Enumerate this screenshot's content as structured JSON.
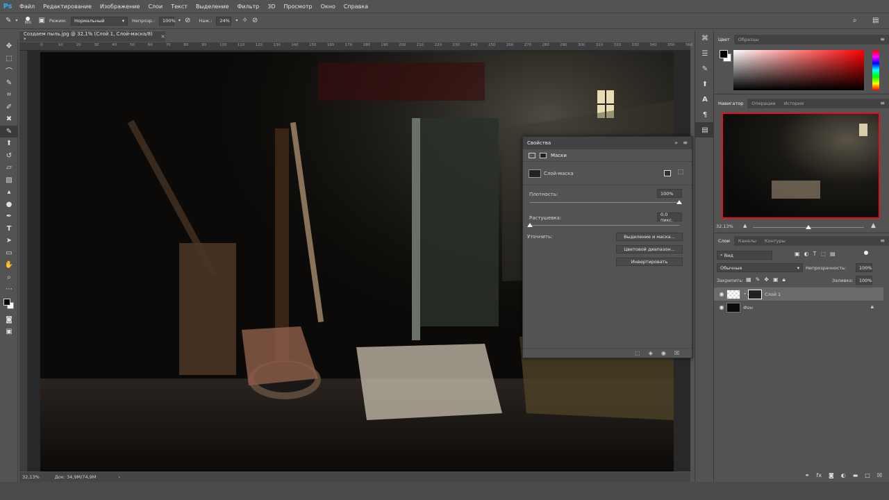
{
  "app": {
    "logo": "Ps"
  },
  "menu": [
    "Файл",
    "Редактирование",
    "Изображение",
    "Слои",
    "Текст",
    "Выделение",
    "Фильтр",
    "3D",
    "Просмотр",
    "Окно",
    "Справка"
  ],
  "options": {
    "brush_size": "800",
    "mode_label": "Режим:",
    "mode_value": "Нормальный",
    "opacity_label": "Непрозр.:",
    "opacity_value": "100%",
    "pressure_label": "Наж.:",
    "pressure_value": "24%"
  },
  "document": {
    "tab_title": "Создаем пыль.jpg @ 32,1% (Слой 1, Слой-маска/8) *",
    "zoom": "32,13%",
    "doc_size": "Док: 34,9M/74,9M"
  },
  "ruler_marks": [
    "0",
    "10",
    "20",
    "30",
    "40",
    "50",
    "60",
    "70",
    "80",
    "90",
    "100",
    "110",
    "120",
    "130",
    "140",
    "150",
    "160",
    "170",
    "180",
    "190",
    "200",
    "210",
    "220",
    "230",
    "240",
    "250",
    "260",
    "270",
    "280",
    "290",
    "300",
    "310",
    "320",
    "330",
    "340",
    "350",
    "360"
  ],
  "tools": [
    "move",
    "marquee",
    "lasso",
    "quick-select",
    "crop",
    "eyedropper",
    "healing",
    "brush",
    "stamp",
    "history-brush",
    "eraser",
    "gradient",
    "blur",
    "dodge",
    "pen",
    "type",
    "path-select",
    "shape",
    "hand",
    "zoom",
    "more",
    "colors",
    "quickmask",
    "screenmode"
  ],
  "properties": {
    "title": "Свойства",
    "section": "Маски",
    "mask_name": "Слой-маска",
    "density_label": "Плотность:",
    "density_value": "100%",
    "density_fraction": 1.0,
    "feather_label": "Растушевка:",
    "feather_value": "0,0 пикс.",
    "feather_fraction": 0.0,
    "refine_label": "Уточнить:",
    "btn_select_mask": "Выделение и маска...",
    "btn_color_range": "Цветовой диапазон...",
    "btn_invert": "Инвертировать"
  },
  "color_panel": {
    "tabs": [
      "Цвет",
      "Образцы"
    ],
    "fg": "#000000",
    "bg": "#ffffff"
  },
  "navigator": {
    "tabs": [
      "Навигатор",
      "Операции",
      "История"
    ],
    "zoom": "32,13%",
    "zoom_fraction": 0.5
  },
  "layers_panel": {
    "tabs": [
      "Слои",
      "Каналы",
      "Контуры"
    ],
    "filter_kind": "Вид",
    "blend_mode": "Обычные",
    "opacity_label": "Непрозрачность:",
    "opacity_value": "100%",
    "lock_label": "Закрепить:",
    "fill_label": "Заливка:",
    "fill_value": "100%",
    "layers": [
      {
        "name": "Слой 1",
        "selected": true
      },
      {
        "name": "Фон",
        "selected": false
      }
    ]
  },
  "colors": {
    "accent_red": "#e01020",
    "ps_blue": "#31a8ff"
  }
}
